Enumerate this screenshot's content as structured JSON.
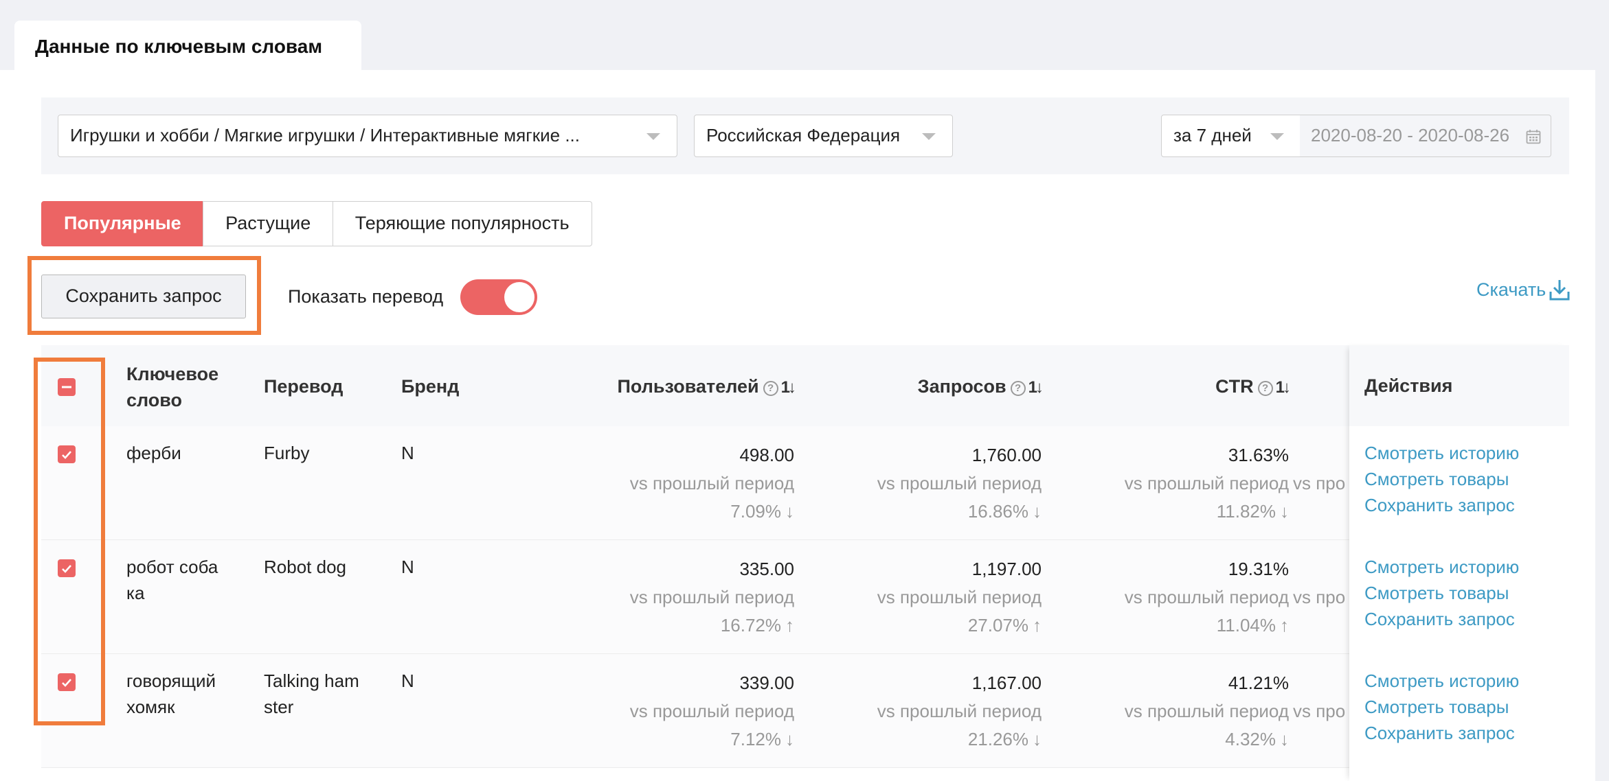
{
  "tab_title": "Данные по ключевым словам",
  "filters": {
    "category": "Игрушки и хобби / Мягкие игрушки / Интерактивные мягкие ...",
    "region": "Российская Федерация",
    "period": "за 7 дней",
    "date_range": "2020-08-20 - 2020-08-26"
  },
  "segments": [
    "Популярные",
    "Растущие",
    "Теряющие популярность"
  ],
  "save_query_button": "Сохранить запрос",
  "translation_toggle": {
    "label": "Показать перевод",
    "on": true
  },
  "download_label": "Скачать",
  "table": {
    "headers": {
      "keyword_line1": "Ключевое",
      "keyword_line2": "слово",
      "translation": "Перевод",
      "brand": "Бренд",
      "users": "Пользователей",
      "queries": "Запросов",
      "ctr": "CTR",
      "actions": "Действия"
    },
    "vs_label": "vs прошлый период",
    "vs_partial": "vs про",
    "rows": [
      {
        "keyword_line1": "ферби",
        "keyword_line2": "",
        "translation_line1": "Furby",
        "translation_line2": "",
        "brand": "N",
        "users": "498.00",
        "users_change": "7.09%",
        "users_dir": "↓",
        "queries": "1,760.00",
        "queries_change": "16.86%",
        "queries_dir": "↓",
        "ctr": "31.63%",
        "ctr_change": "11.82%",
        "ctr_dir": "↓"
      },
      {
        "keyword_line1": "робот соба",
        "keyword_line2": "ка",
        "translation_line1": "Robot dog",
        "translation_line2": "",
        "brand": "N",
        "users": "335.00",
        "users_change": "16.72%",
        "users_dir": "↑",
        "queries": "1,197.00",
        "queries_change": "27.07%",
        "queries_dir": "↑",
        "ctr": "19.31%",
        "ctr_change": "11.04%",
        "ctr_dir": "↑"
      },
      {
        "keyword_line1": "говорящий",
        "keyword_line2": "хомяк",
        "translation_line1": "Talking ham",
        "translation_line2": "ster",
        "brand": "N",
        "users": "339.00",
        "users_change": "7.12%",
        "users_dir": "↓",
        "queries": "1,167.00",
        "queries_change": "21.26%",
        "queries_dir": "↓",
        "ctr": "41.21%",
        "ctr_change": "4.32%",
        "ctr_dir": "↓"
      }
    ],
    "row_actions": [
      "Смотреть историю",
      "Смотреть товары",
      "Сохранить запрос"
    ]
  },
  "colors": {
    "accent": "#ec6464",
    "link": "#3d9ac4",
    "highlight": "#f07c3c"
  }
}
